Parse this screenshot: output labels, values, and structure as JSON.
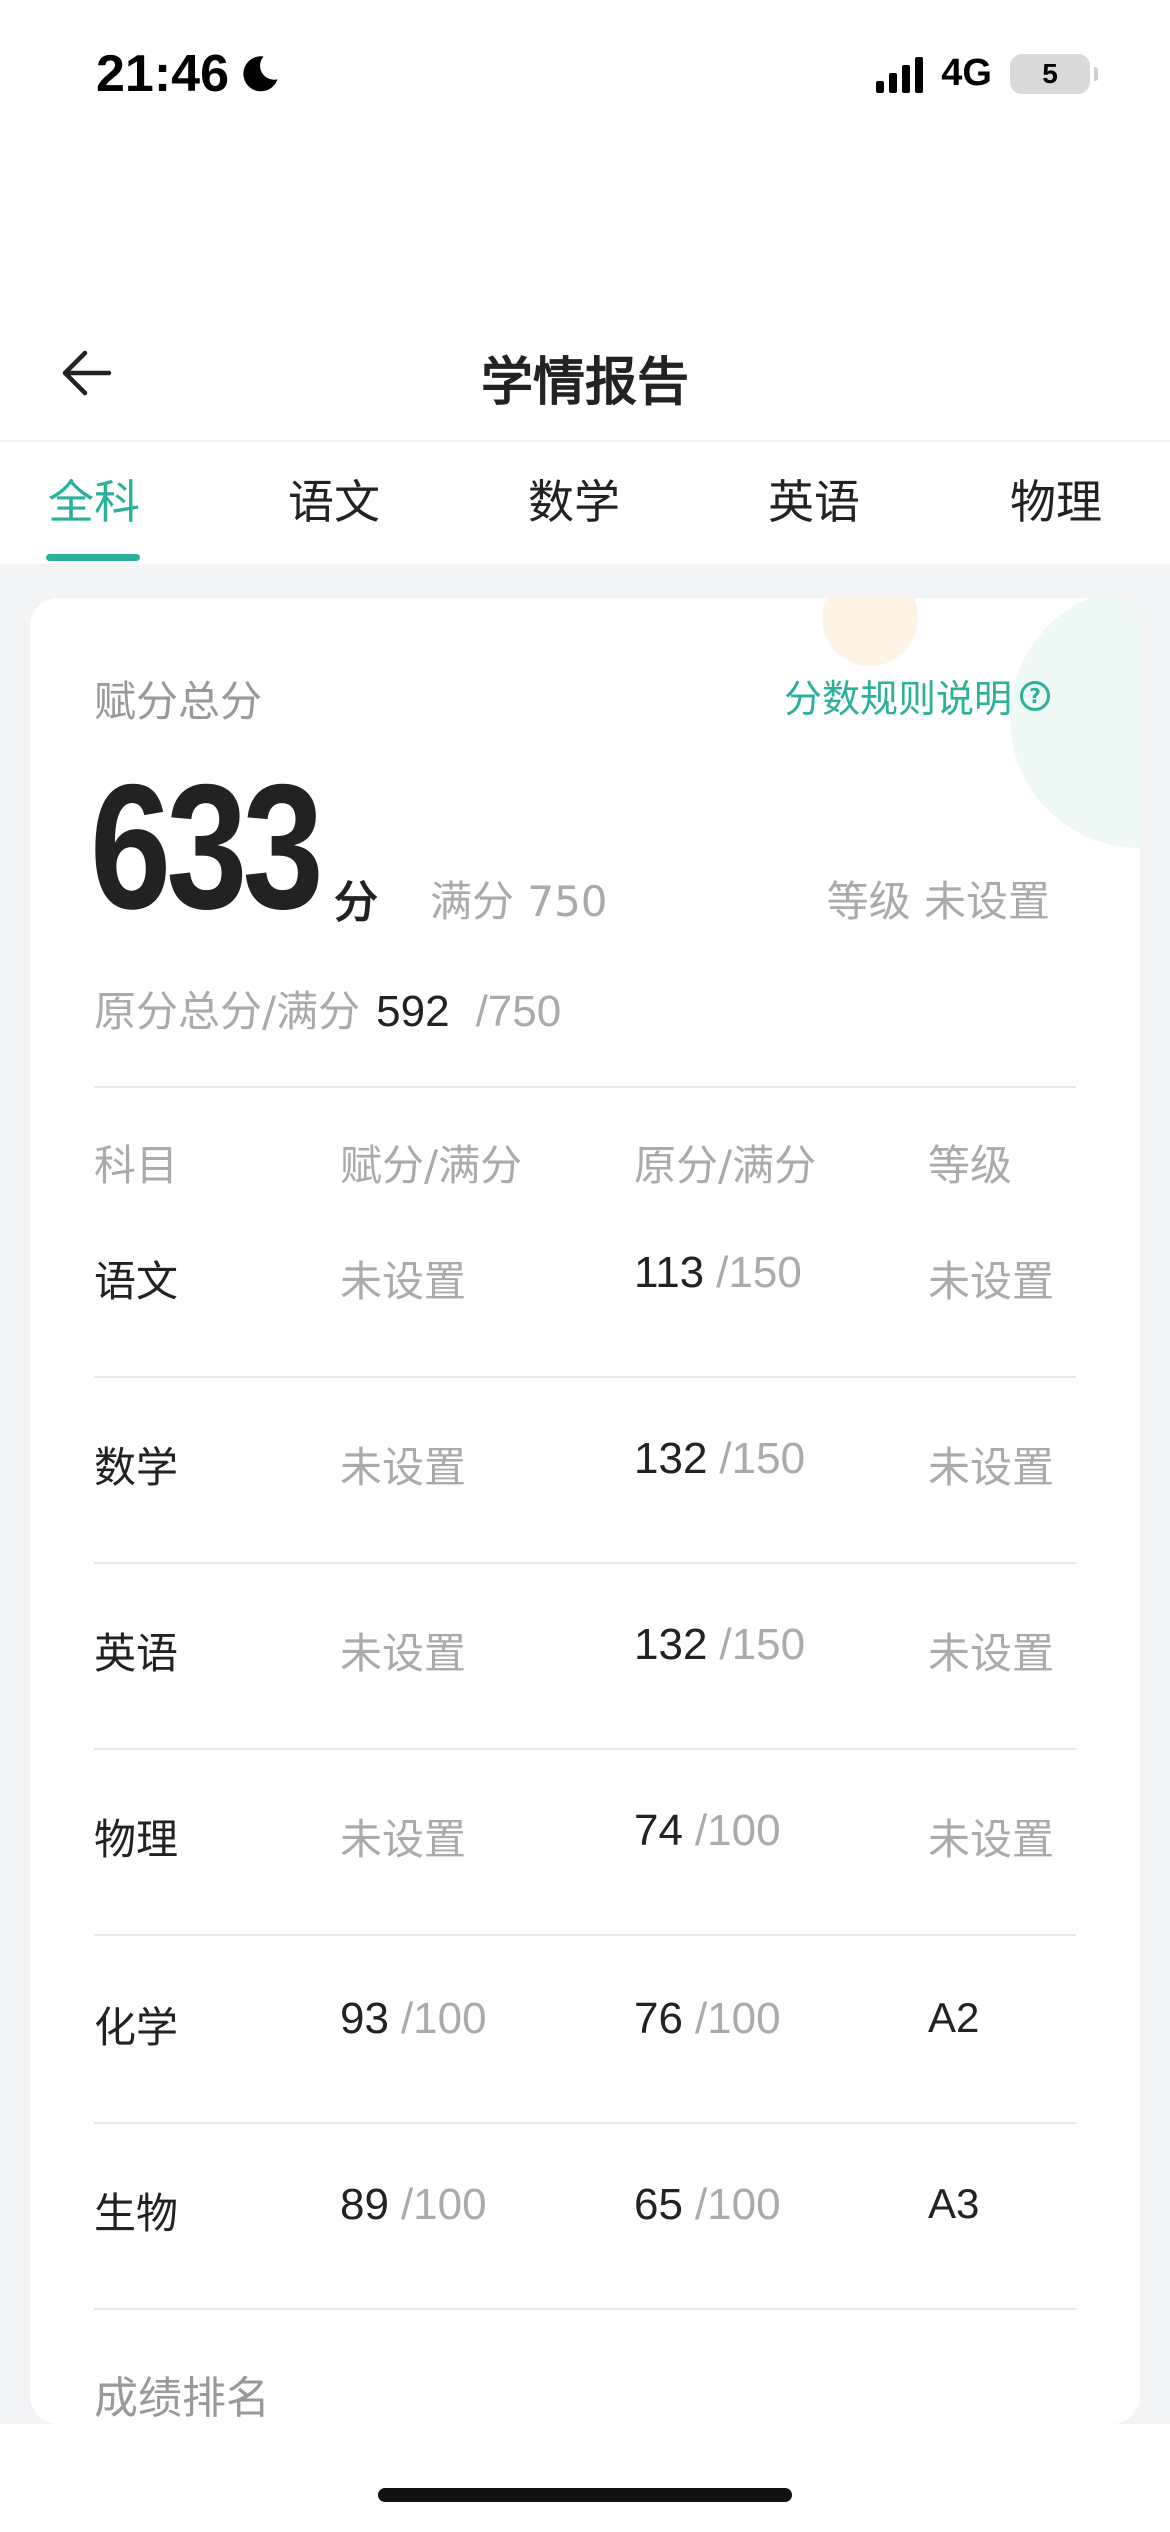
{
  "status_bar": {
    "time": "21:46",
    "network": "4G",
    "battery": "5"
  },
  "header": {
    "title": "学情报告"
  },
  "tabs": [
    {
      "label": "全科",
      "active": true
    },
    {
      "label": "语文",
      "active": false
    },
    {
      "label": "数学",
      "active": false
    },
    {
      "label": "英语",
      "active": false
    },
    {
      "label": "物理",
      "active": false
    }
  ],
  "summary": {
    "total_label": "赋分总分",
    "rules_link": "分数规则说明",
    "score": "633",
    "score_unit": "分",
    "full_score": "满分 750",
    "grade": "等级 未设置",
    "raw_label": "原分总分/满分",
    "raw_score": "592",
    "raw_full": "/750"
  },
  "table": {
    "headers": [
      "科目",
      "赋分/满分",
      "原分/满分",
      "等级"
    ],
    "rows": [
      {
        "subject": "语文",
        "assigned": "未设置",
        "assigned_full": "",
        "raw": "113",
        "raw_full": "/150",
        "grade": "未设置"
      },
      {
        "subject": "数学",
        "assigned": "未设置",
        "assigned_full": "",
        "raw": "132",
        "raw_full": "/150",
        "grade": "未设置"
      },
      {
        "subject": "英语",
        "assigned": "未设置",
        "assigned_full": "",
        "raw": "132",
        "raw_full": "/150",
        "grade": "未设置"
      },
      {
        "subject": "物理",
        "assigned": "未设置",
        "assigned_full": "",
        "raw": "74",
        "raw_full": "/100",
        "grade": "未设置"
      },
      {
        "subject": "化学",
        "assigned": "93",
        "assigned_full": "/100",
        "raw": "76",
        "raw_full": "/100",
        "grade": "A2"
      },
      {
        "subject": "生物",
        "assigned": "89",
        "assigned_full": "/100",
        "raw": "65",
        "raw_full": "/100",
        "grade": "A3"
      }
    ]
  },
  "ranking": {
    "label": "成绩排名"
  },
  "colors": {
    "accent": "#2bb09a",
    "background": "#f3f4f6"
  }
}
